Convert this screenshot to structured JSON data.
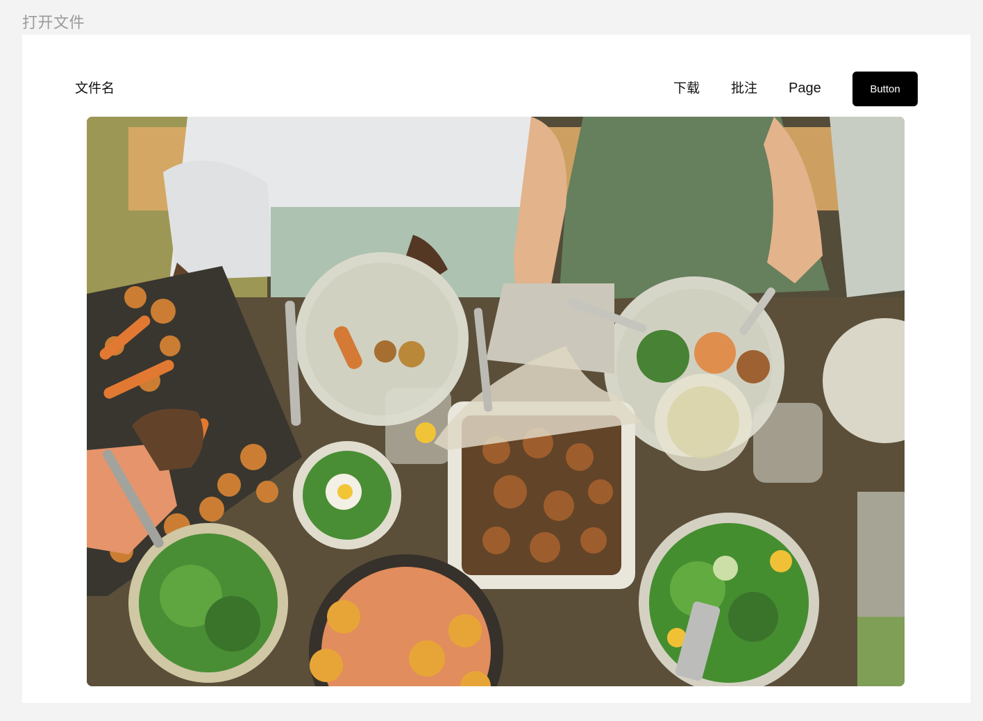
{
  "page": {
    "label": "打开文件"
  },
  "header": {
    "file_name": "文件名",
    "nav": {
      "download": "下载",
      "annotate": "批注",
      "page": "Page"
    },
    "button_label": "Button"
  },
  "image": {
    "alt": "Overhead photo of a shared outdoor meal: plates, salads, roasted vegetables, salmon and glasses on a table"
  },
  "colors": {
    "button_background": "#000000",
    "button_text": "#ffffff",
    "page_background": "#f3f3f3",
    "card_background": "#ffffff"
  }
}
